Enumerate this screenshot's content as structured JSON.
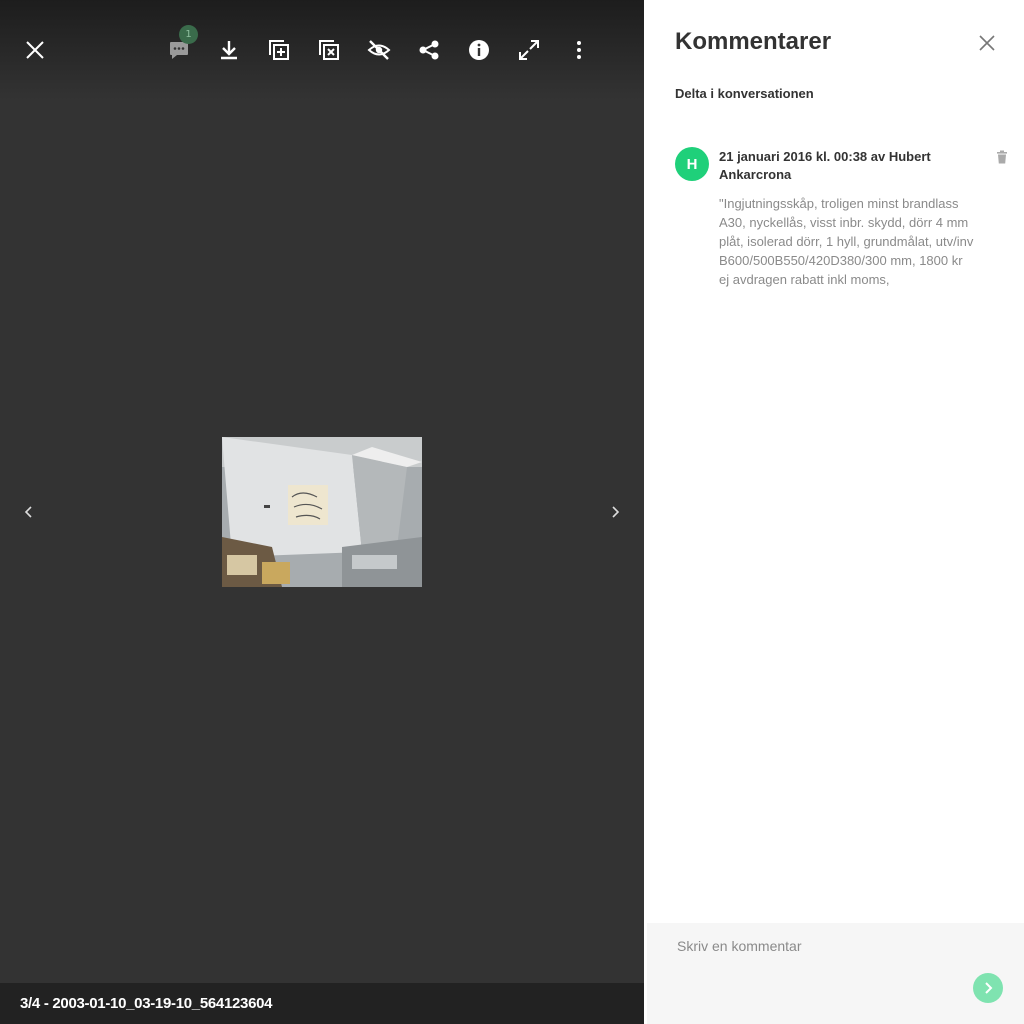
{
  "viewer": {
    "comment_count": "1",
    "footer_caption": "3/4 - 2003-01-10_03-19-10_564123604",
    "toolbar_icons": [
      "close-icon",
      "comment-icon",
      "download-icon",
      "add-to-album-icon",
      "remove-from-album-icon",
      "hide-icon",
      "share-icon",
      "info-icon",
      "fullscreen-icon",
      "more-icon"
    ]
  },
  "comments_panel": {
    "title": "Kommentarer",
    "join_label": "Delta i konversationen",
    "comment": {
      "avatar_initial": "H",
      "header": "21 januari 2016 kl. 00:38 av Hubert Ankarcrona",
      "body": "\"Ingjutningsskåp, troligen minst brandlass A30, nyckellås, visst inbr. skydd, dörr 4 mm plåt, isolerad dörr, 1 hyll, grundmålat, utv/inv B600/500B550/420D380/300 mm, 1800 kr ej avdragen rabatt inkl moms,"
    },
    "input_placeholder": "Skriv en kommentar"
  },
  "colors": {
    "avatar": "#1fd07a",
    "send_button": "#7fe3b0",
    "badge": "#3a6b4b"
  }
}
